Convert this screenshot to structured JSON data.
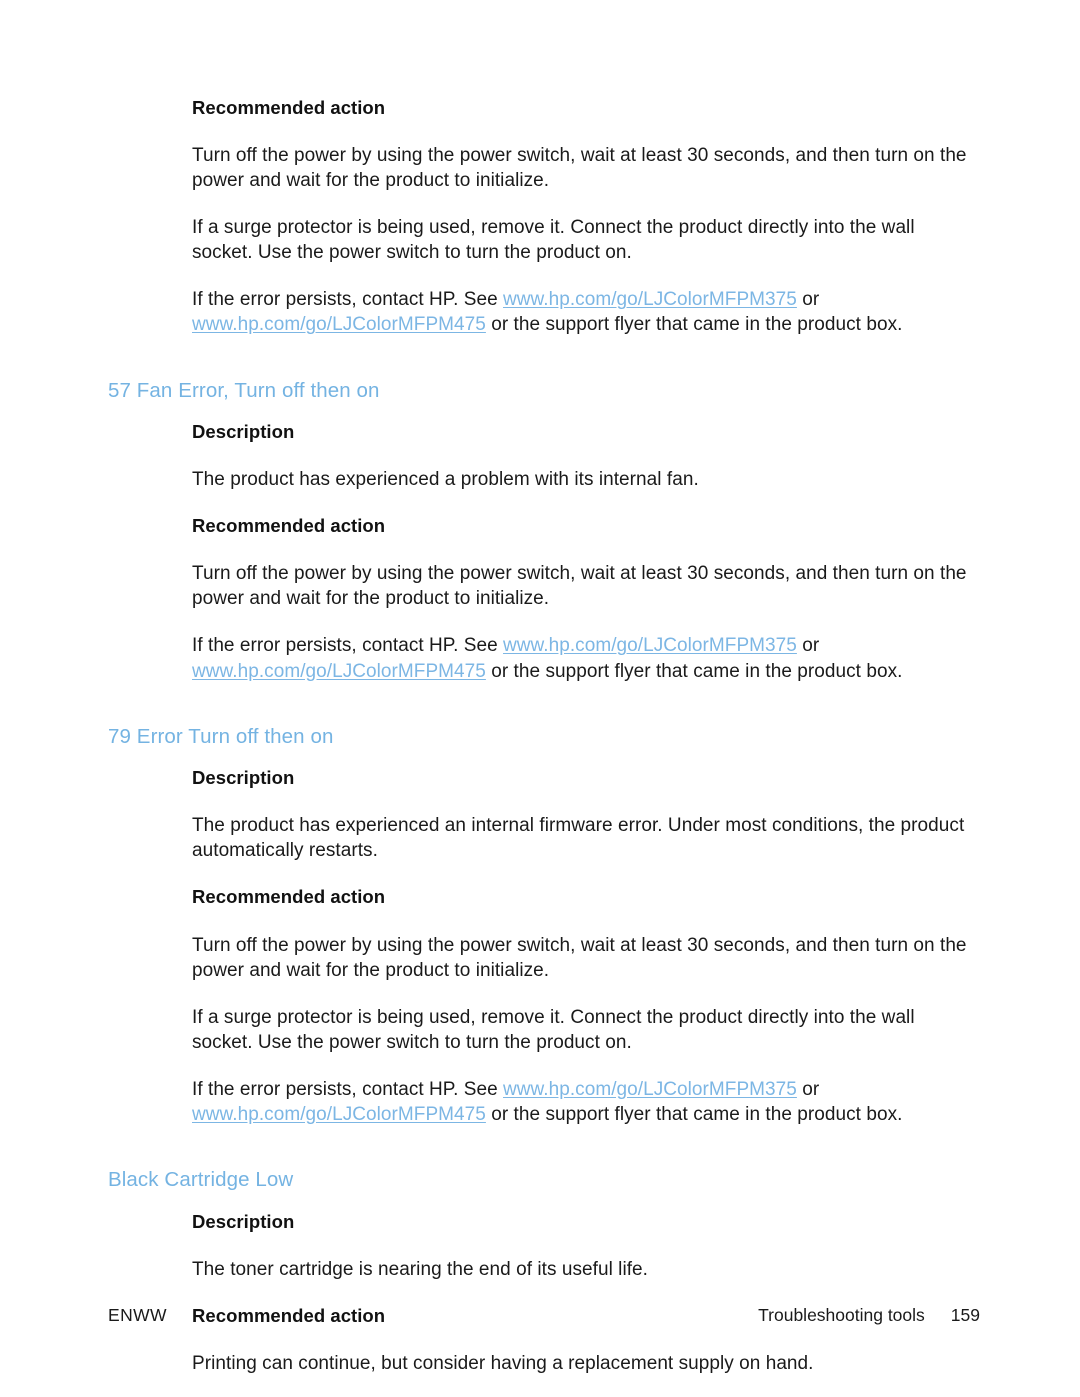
{
  "page": {
    "labels": {
      "description": "Description",
      "recommended_action": "Recommended action"
    },
    "colors": {
      "heading": "#74b3e2",
      "link": "#7cb6e4",
      "body_text": "#1a1a1a",
      "background": "#ffffff"
    }
  },
  "top_section": {
    "heading_recommended_action": "Recommended action",
    "paragraph_1": "Turn off the power by using the power switch, wait at least 30 seconds, and then turn on the power and wait for the product to initialize.",
    "paragraph_2": "If a surge protector is being used, remove it. Connect the product directly into the wall socket. Use the power switch to turn the product on.",
    "paragraph_3": {
      "lead": "If the error persists, contact HP. See ",
      "link_1": "www.hp.com/go/LJColorMFPM375",
      "between": " or ",
      "link_2": "www.hp.com/go/LJColorMFPM475",
      "tail": " or the support flyer that came in the product box."
    }
  },
  "section_57": {
    "heading": "57 Fan Error, Turn off then on",
    "description_label": "Description",
    "description_text": "The product has experienced a problem with its internal fan.",
    "recommended_label": "Recommended action",
    "paragraph_1": "Turn off the power by using the power switch, wait at least 30 seconds, and then turn on the power and wait for the product to initialize.",
    "paragraph_2": {
      "lead": "If the error persists, contact HP. See ",
      "link_1": "www.hp.com/go/LJColorMFPM375",
      "between": " or ",
      "link_2": "www.hp.com/go/LJColorMFPM475",
      "tail": " or the support flyer that came in the product box."
    }
  },
  "section_79": {
    "heading": "79 Error Turn off then on",
    "description_label": "Description",
    "description_text": "The product has experienced an internal firmware error. Under most conditions, the product automatically restarts.",
    "recommended_label": "Recommended action",
    "paragraph_1": "Turn off the power by using the power switch, wait at least 30 seconds, and then turn on the power and wait for the product to initialize.",
    "paragraph_2": "If a surge protector is being used, remove it. Connect the product directly into the wall socket. Use the power switch to turn the product on.",
    "paragraph_3": {
      "lead": "If the error persists, contact HP. See ",
      "link_1": "www.hp.com/go/LJColorMFPM375",
      "between": " or ",
      "link_2": "www.hp.com/go/LJColorMFPM475",
      "tail": " or the support flyer that came in the product box."
    }
  },
  "section_black_cartridge": {
    "heading": "Black Cartridge Low",
    "description_label": "Description",
    "description_text": "The toner cartridge is nearing the end of its useful life.",
    "recommended_label": "Recommended action",
    "paragraph_1": "Printing can continue, but consider having a replacement supply on hand."
  },
  "footer": {
    "left": "ENWW",
    "chapter": "Troubleshooting tools",
    "page_number": "159"
  }
}
